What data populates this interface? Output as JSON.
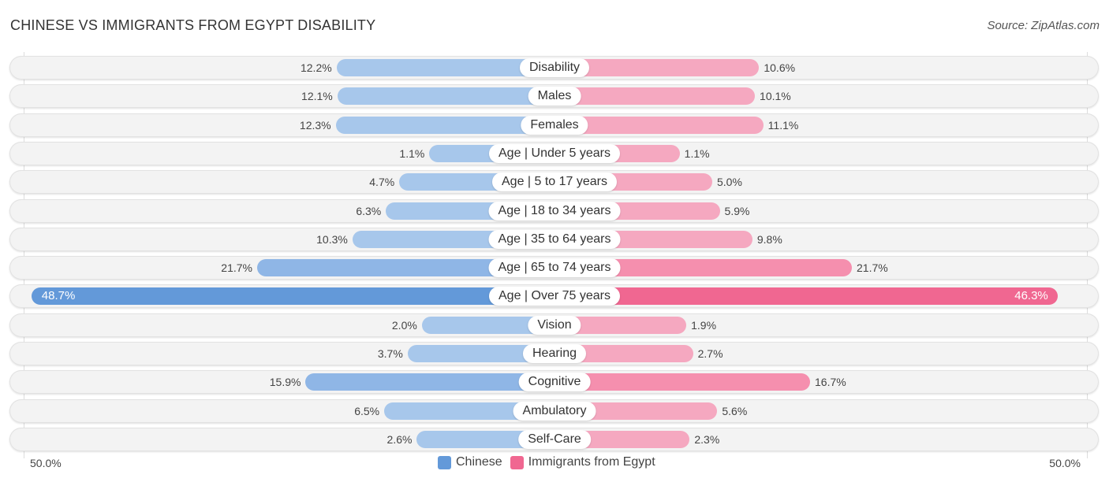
{
  "header": {
    "title": "CHINESE VS IMMIGRANTS FROM EGYPT DISABILITY",
    "source": "Source: ZipAtlas.com"
  },
  "colors": {
    "chinese_strong": "#6399d9",
    "chinese_light": "#a7c7eb",
    "egypt_strong": "#f06791",
    "egypt_light": "#f5a8c0"
  },
  "chart_data": {
    "type": "bar",
    "orientation": "horizontal-diverging",
    "title": "CHINESE VS IMMIGRANTS FROM EGYPT DISABILITY",
    "categories": [
      "Disability",
      "Males",
      "Females",
      "Age | Under 5 years",
      "Age | 5 to 17 years",
      "Age | 18 to 34 years",
      "Age | 35 to 64 years",
      "Age | 65 to 74 years",
      "Age | Over 75 years",
      "Vision",
      "Hearing",
      "Cognitive",
      "Ambulatory",
      "Self-Care"
    ],
    "series": [
      {
        "name": "Chinese",
        "side": "left",
        "values": [
          12.2,
          12.1,
          12.3,
          1.1,
          4.7,
          6.3,
          10.3,
          21.7,
          48.7,
          2.0,
          3.7,
          15.9,
          6.5,
          2.6
        ],
        "labels": [
          "12.2%",
          "12.1%",
          "12.3%",
          "1.1%",
          "4.7%",
          "6.3%",
          "10.3%",
          "21.7%",
          "48.7%",
          "2.0%",
          "3.7%",
          "15.9%",
          "6.5%",
          "2.6%"
        ]
      },
      {
        "name": "Immigrants from Egypt",
        "side": "right",
        "values": [
          10.6,
          10.1,
          11.1,
          1.1,
          5.0,
          5.9,
          9.8,
          21.7,
          46.3,
          1.9,
          2.7,
          16.7,
          5.6,
          2.3
        ],
        "labels": [
          "10.6%",
          "10.1%",
          "11.1%",
          "1.1%",
          "5.0%",
          "5.9%",
          "9.8%",
          "21.7%",
          "46.3%",
          "1.9%",
          "2.7%",
          "16.7%",
          "5.6%",
          "2.3%"
        ]
      }
    ],
    "axis": {
      "min_label": "50.0%",
      "max_label": "50.0%",
      "range": [
        0,
        50
      ]
    },
    "legend": {
      "position": "bottom-center",
      "entries": [
        "Chinese",
        "Immigrants from Egypt"
      ]
    }
  }
}
